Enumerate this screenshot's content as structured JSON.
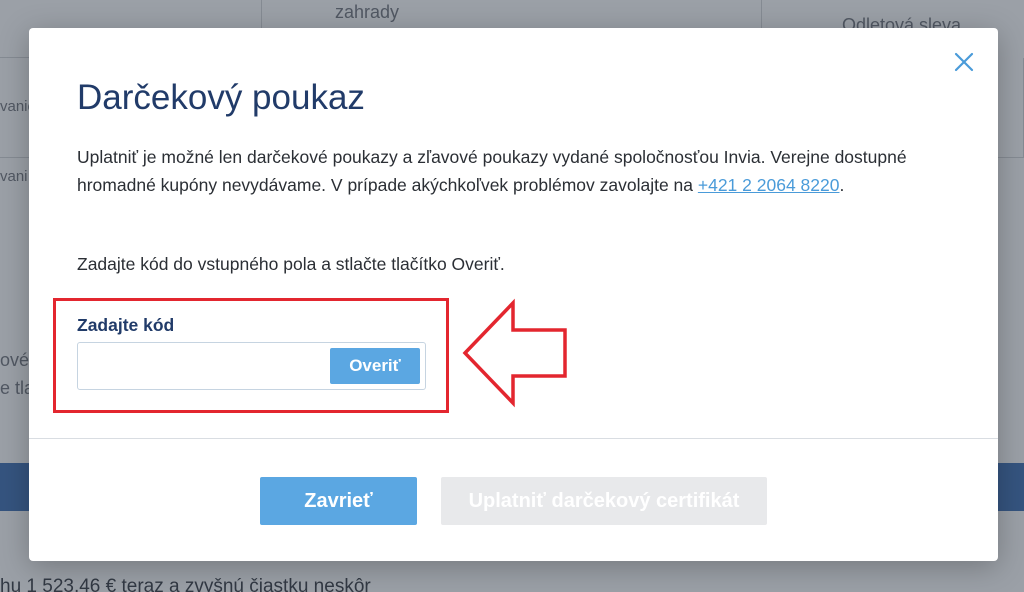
{
  "background": {
    "top_text_1": "zahrady",
    "top_text_2": "Odletová sleva",
    "left_frag_1": "vanie",
    "left_frag_2": "vani",
    "left_frag_3": "ové",
    "left_frag_4": "e tla",
    "footer_text": "hu 1 523,46 € teraz a zvyšnú čiastku neskôr"
  },
  "modal": {
    "title": "Darčekový poukaz",
    "description_text": "Uplatniť je možné len darčekové poukazy a zľavové poukazy vydané spoločnosťou Invia. Verejne dostupné hromadné kupóny nevydávame. V prípade akýchkoľvek problémov zavolajte na ",
    "phone_link": "+421 2 2064 8220",
    "description_end": ".",
    "hint": "Zadajte kód do vstupného pola a stlačte tlačítko Overiť.",
    "code_label": "Zadajte kód",
    "code_value": "",
    "verify_label": "Overiť",
    "close_label": "Zavrieť",
    "apply_label": "Uplatniť darčekový certifikát",
    "close_icon": "close-icon"
  },
  "colors": {
    "title": "#213b69",
    "primary_button": "#5ba7e2",
    "disabled_button": "#e8e9eb",
    "highlight": "#e3262f",
    "link": "#4a9bd9"
  }
}
